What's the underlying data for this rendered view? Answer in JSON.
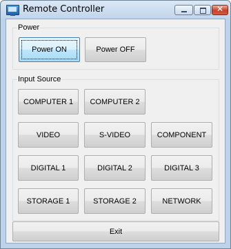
{
  "window": {
    "title": "Remote Controller",
    "controls": {
      "minimize_icon": "minimize-icon",
      "maximize_icon": "maximize-icon",
      "close_glyph": "✕"
    }
  },
  "power": {
    "legend": "Power",
    "on_label": "Power ON",
    "off_label": "Power OFF"
  },
  "input_source": {
    "legend": "Input Source",
    "computer1": "COMPUTER 1",
    "computer2": "COMPUTER 2",
    "video": "VIDEO",
    "svideo": "S-VIDEO",
    "component": "COMPONENT",
    "digital1": "DIGITAL 1",
    "digital2": "DIGITAL 2",
    "digital3": "DIGITAL 3",
    "storage1": "STORAGE 1",
    "storage2": "STORAGE 2",
    "network": "NETWORK"
  },
  "footer": {
    "exit_label": "Exit"
  },
  "colors": {
    "titlebar": "#c3d6ec",
    "client_bg": "#f0f0f0",
    "close_button": "#c4422a"
  }
}
